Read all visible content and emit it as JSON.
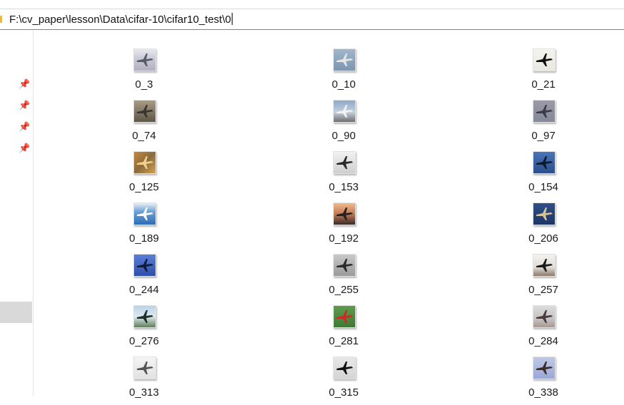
{
  "address_bar": {
    "path": "F:\\cv_paper\\lesson\\Data\\cifar-10\\cifar10_test\\0"
  },
  "nav_pane": {
    "pins": [
      "pin-icon",
      "pin-icon",
      "pin-icon",
      "pin-icon"
    ]
  },
  "files": [
    {
      "name": "0_3",
      "bg": "linear-gradient(#e8e8f0 0%, #c9c9d6 45%, #b0b0c0 100%)",
      "fg": "#5a5a66"
    },
    {
      "name": "0_10",
      "bg": "linear-gradient(#9fb6cc, #7d96ae)",
      "fg": "#e6e6e6"
    },
    {
      "name": "0_21",
      "bg": "linear-gradient(#f4f4ee, #e9e9e2)",
      "fg": "#111111"
    },
    {
      "name": "0_74",
      "bg": "linear-gradient(#a89c86, #5e5648)",
      "fg": "#3b352c"
    },
    {
      "name": "0_90",
      "bg": "linear-gradient(#8fa9c9 0%, #c4d0de 55%, #6e6e6e 100%)",
      "fg": "#f2f2f2"
    },
    {
      "name": "0_97",
      "bg": "linear-gradient(#9a9ba8, #868897)",
      "fg": "#3c3c48"
    },
    {
      "name": "0_125",
      "bg": "linear-gradient(135deg, #c48a3c, #8a6a3e 50%, #d4a24c)",
      "fg": "#f0d08a"
    },
    {
      "name": "0_153",
      "bg": "linear-gradient(#f2f2f2, #cfcfcf)",
      "fg": "#2a2a2a"
    },
    {
      "name": "0_154",
      "bg": "linear-gradient(#4a74b8, #2c4f8e)",
      "fg": "#0e1a2e"
    },
    {
      "name": "0_189",
      "bg": "linear-gradient(#e8eef6 0%, #6aa0d6 40%, #2c6db8 100%)",
      "fg": "#ffffff"
    },
    {
      "name": "0_192",
      "bg": "linear-gradient(#f2b98a 0%, #c07c56 50%, #3a2a2a 100%)",
      "fg": "#2a1e1e"
    },
    {
      "name": "0_206",
      "bg": "linear-gradient(#2e4f86, #1c3566)",
      "fg": "#d8c29a"
    },
    {
      "name": "0_244",
      "bg": "linear-gradient(#5a7ed6, #2f4faa)",
      "fg": "#0e1a3e"
    },
    {
      "name": "0_255",
      "bg": "linear-gradient(#c8c8c8, #9a9a9a)",
      "fg": "#2a2a2a"
    },
    {
      "name": "0_257",
      "bg": "linear-gradient(#f4f2ee 0%, #e0dcd6 60%, #8a7a6a 100%)",
      "fg": "#1a1a1a"
    },
    {
      "name": "0_276",
      "bg": "linear-gradient(#b8d4e6 0%, #dfe9f0 50%, #5f7f5a 100%)",
      "fg": "#1e2e2a"
    },
    {
      "name": "0_281",
      "bg": "linear-gradient(#5f9a4e, #3e7a34)",
      "fg": "#d02828"
    },
    {
      "name": "0_284",
      "bg": "linear-gradient(#dcdcdc 0%, #c4c4c4 60%, #a89890 100%)",
      "fg": "#4a3a3a"
    },
    {
      "name": "0_313",
      "bg": "linear-gradient(#f4f4f4, #e2e2e2)",
      "fg": "#555555"
    },
    {
      "name": "0_315",
      "bg": "linear-gradient(#e8e8e8, #d4d4d4)",
      "fg": "#111111"
    },
    {
      "name": "0_338",
      "bg": "linear-gradient(#bfc8e6, #9aa8d6)",
      "fg": "#3a2e2a"
    }
  ]
}
